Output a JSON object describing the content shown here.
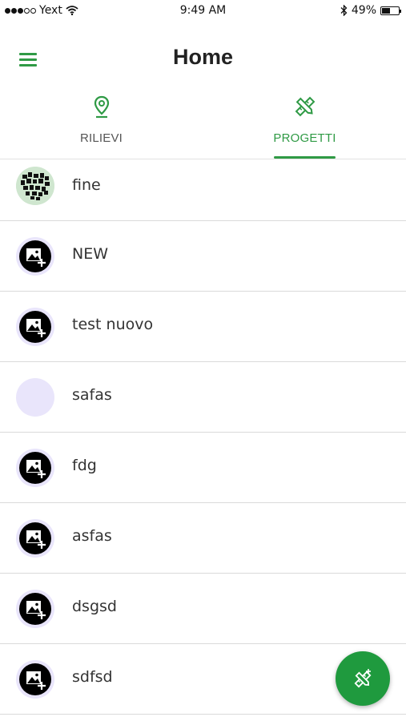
{
  "status_bar": {
    "carrier": "Yext",
    "time": "9:49 AM",
    "battery_percent": "49%",
    "signal_icon": "signal-dots-icon",
    "wifi_icon": "wifi-icon",
    "bluetooth_icon": "bluetooth-icon",
    "battery_icon": "battery-icon",
    "battery_level": 0.49
  },
  "header": {
    "title": "Home",
    "menu_icon": "hamburger-menu-icon"
  },
  "tabs": [
    {
      "label": "RILIEVI",
      "icon": "map-pin-icon",
      "selected": false
    },
    {
      "label": "PROGETTI",
      "icon": "ruler-pencil-icon",
      "selected": true
    }
  ],
  "projects": [
    {
      "name": "fine",
      "avatar": "custom-photo"
    },
    {
      "name": "NEW",
      "avatar": "add-image-icon"
    },
    {
      "name": "test nuovo",
      "avatar": "add-image-icon"
    },
    {
      "name": "safas",
      "avatar": "empty"
    },
    {
      "name": "fdg",
      "avatar": "add-image-icon"
    },
    {
      "name": "asfas",
      "avatar": "add-image-icon"
    },
    {
      "name": "dsgsd",
      "avatar": "add-image-icon"
    },
    {
      "name": "sdfsd",
      "avatar": "add-image-icon"
    }
  ],
  "fab": {
    "icon": "add-project-icon"
  },
  "colors": {
    "accent": "#2f9a45",
    "fab": "#1f9a3e",
    "avatar_bg": "#e9e5fb",
    "divider": "#dadada"
  }
}
